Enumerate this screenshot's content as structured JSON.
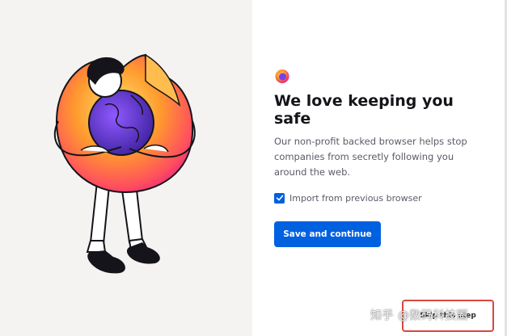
{
  "onboarding": {
    "title": "We love keeping you safe",
    "subtitle": "Our non-profit backed browser helps stop companies from secretly following you around the web.",
    "import_checkbox": {
      "label": "Import from previous browser",
      "checked": true
    },
    "primary_button": "Save and continue",
    "skip_button": "Skip this step",
    "accent_color": "#0061e0",
    "highlight_color": "#d9473c"
  },
  "watermark": {
    "text": "知乎 @数码科技圈"
  },
  "icons": {
    "logo": "firefox-logo-icon",
    "illustration": "person-hugging-firefox-illustration",
    "check": "checkmark-icon"
  }
}
